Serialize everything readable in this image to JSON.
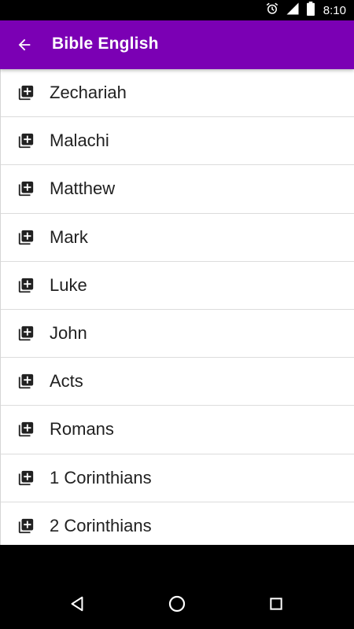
{
  "status_bar": {
    "time": "8:10",
    "icons": [
      "alarm-icon",
      "signal-icon",
      "battery-icon"
    ]
  },
  "app_bar": {
    "title": "Bible English",
    "back_icon": "back-arrow-icon"
  },
  "books": [
    "Zechariah",
    "Malachi",
    "Matthew",
    "Mark",
    "Luke",
    "John",
    "Acts",
    "Romans",
    "1 Corinthians",
    "2 Corinthians"
  ],
  "colors": {
    "app_bar": "#7b00b4",
    "text": "#212121"
  },
  "nav_bar": {
    "icons": [
      "back-triangle-icon",
      "home-circle-icon",
      "recents-square-icon"
    ]
  }
}
